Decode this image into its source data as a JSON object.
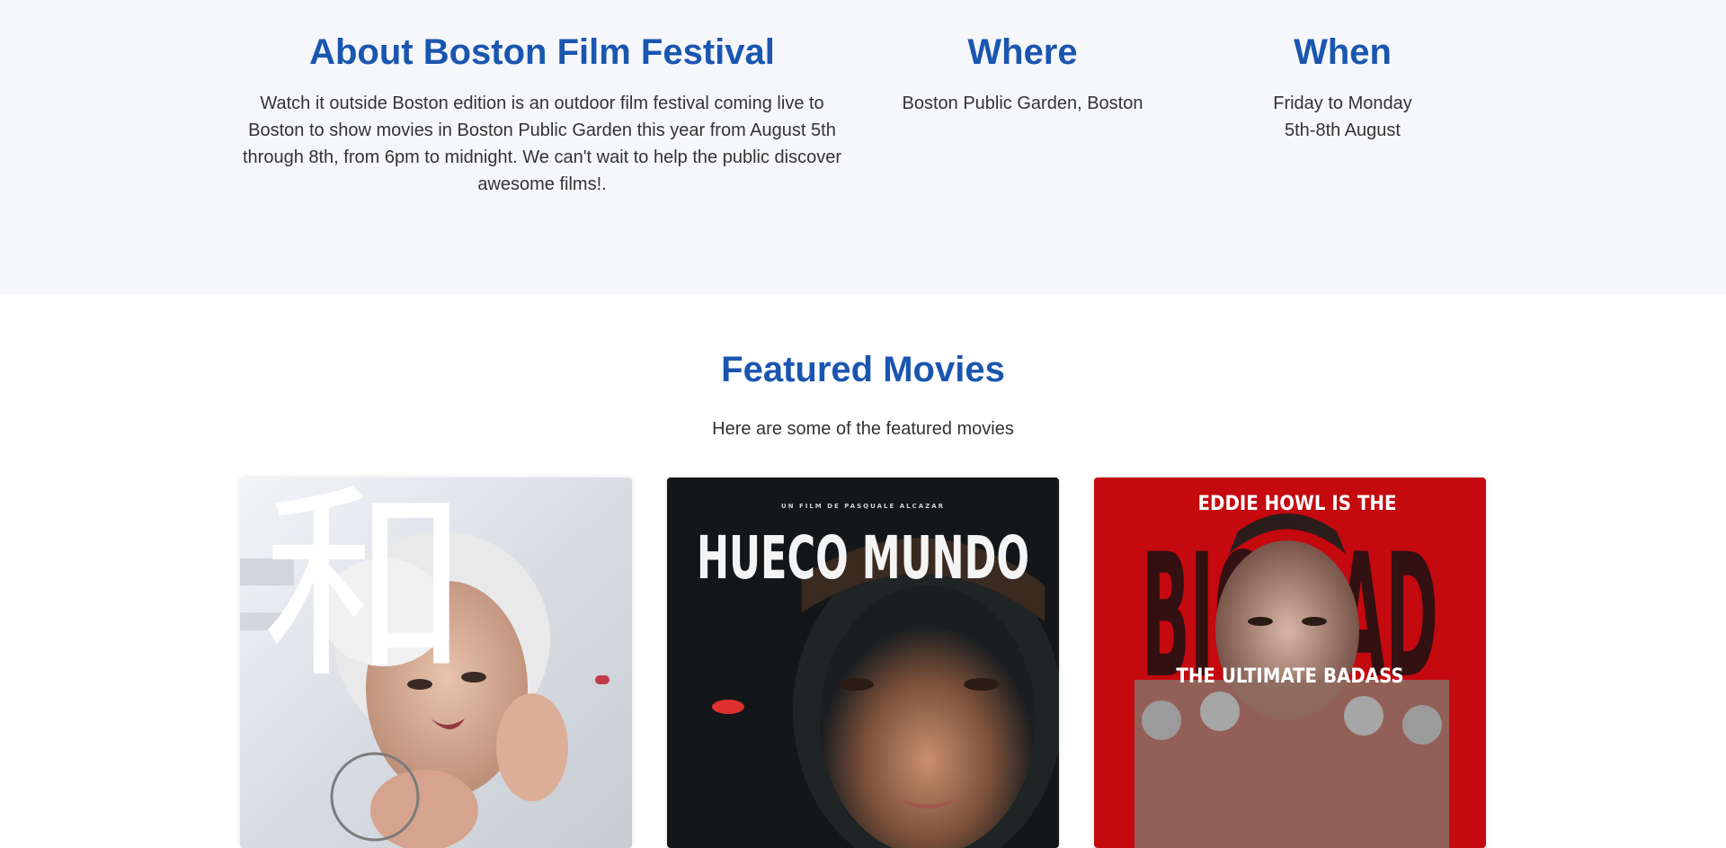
{
  "about": {
    "title": "About Boston Film Festival",
    "text": "Watch it outside Boston edition is an outdoor film festival coming live to Boston to show movies in Boston Public Garden this year from August 5th through 8th, from 6pm to midnight. We can't wait to help the public discover awesome films!."
  },
  "where": {
    "title": "Where",
    "text": "Boston Public Garden, Boston"
  },
  "when": {
    "title": "When",
    "line1": "Friday to Monday",
    "line2": "5th-8th August"
  },
  "featured": {
    "title": "Featured Movies",
    "subtitle": "Here are some of the featured movies",
    "movies": [
      {
        "poster_glyph": "和",
        "background": "#e8ebef"
      },
      {
        "poster_credit": "UN FILM DE PASQUALE ALCAZAR",
        "poster_title": "HUECO MUNDO",
        "background": "#13171a"
      },
      {
        "poster_tagline_top": "EDDIE HOWL IS THE",
        "poster_big_word": "BIG BAD",
        "poster_tagline_mid": "THE ULTIMATE BADASS",
        "background": "#c4090f"
      }
    ]
  },
  "colors": {
    "heading": "#1a56b0",
    "about_bg": "#f6f7fb",
    "body_text": "#333333"
  }
}
